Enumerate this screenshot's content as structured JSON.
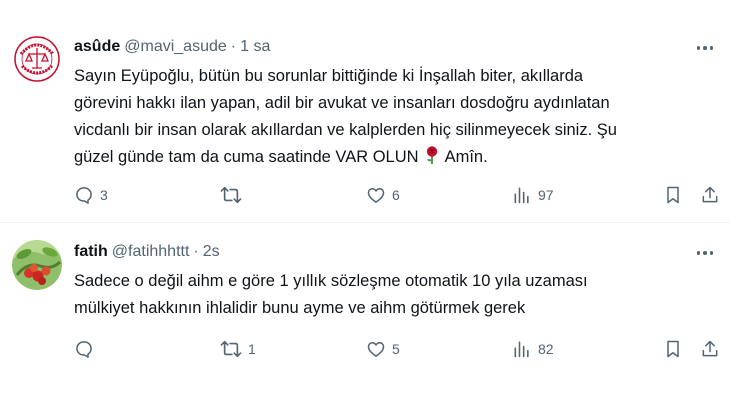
{
  "tweets": [
    {
      "author": {
        "name": "asûde",
        "handle": "@mavi_asude",
        "time": "1 sa"
      },
      "text_lines": [
        "Sayın Eyüpoğlu, bütün bu sorunlar bittiğinde ki İnşallah biter, akıllarda",
        "görevini hakkı ilan yapan, adil bir avukat ve insanları dosdoğru aydınlatan",
        "vicdanlı bir insan olarak akıllardan ve kalplerden hiç silinmeyecek siniz. Şu",
        "güzel günde tam da cuma saatinde VAR OLUN",
        "Amîn."
      ],
      "emoji": "rose",
      "stats": {
        "replies": "3",
        "reposts": "",
        "likes": "6",
        "views": "97"
      }
    },
    {
      "author": {
        "name": "fatih",
        "handle": "@fatihhhttt",
        "time": "2s"
      },
      "text_lines": [
        "Sadece o değil aihm e göre 1 yıllık sözleşme otomatik 10 yıla uzaması",
        "mülkiyet hakkının ihlalidir bunu ayme ve aihm götürmek gerek"
      ],
      "stats": {
        "replies": "",
        "reposts": "1",
        "likes": "5",
        "views": "82"
      }
    }
  ],
  "icons": [
    "reply-icon",
    "repost-icon",
    "like-icon",
    "views-icon",
    "bookmark-icon",
    "share-icon",
    "more-icon"
  ],
  "colors": {
    "text": "#0f1419",
    "secondary": "#536471",
    "divider": "#eff3f4",
    "rose": "#c8102e"
  },
  "avatar_1_text": {
    "top": "EYÜPOĞLU",
    "bottom": "HALKI ADİL"
  }
}
